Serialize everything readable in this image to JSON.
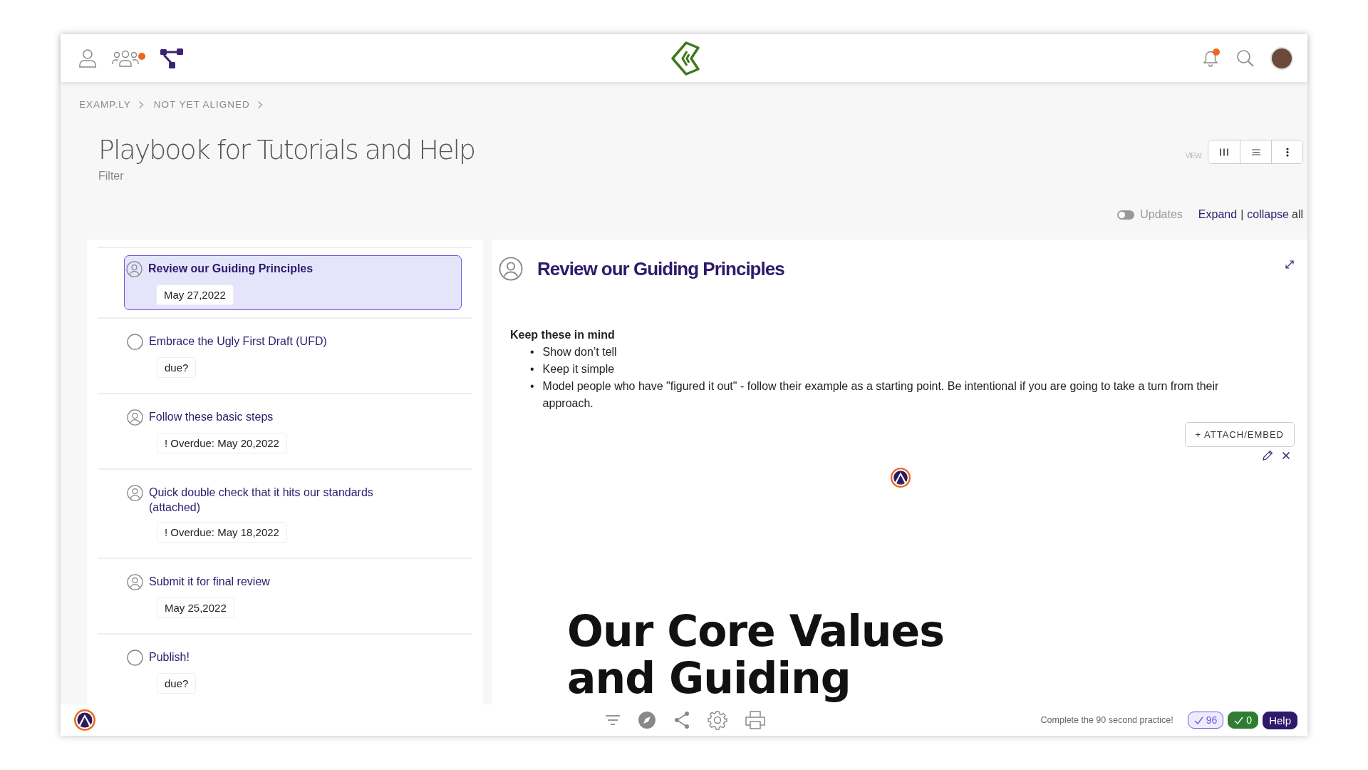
{
  "top_bar": {
    "people_has_alert": true,
    "bell_has_alert": true
  },
  "breadcrumb": [
    "EXAMP.LY",
    "NOT YET ALIGNED"
  ],
  "page": {
    "title": "Playbook for Tutorials and Help",
    "filter_label": "Filter"
  },
  "view": {
    "label": "VIEW:",
    "buttons": [
      {
        "kind": "columns",
        "selected": false
      },
      {
        "kind": "list",
        "selected": false
      },
      {
        "kind": "more",
        "selected": false
      }
    ]
  },
  "updates_toggle": {
    "label": "Updates",
    "on": false
  },
  "expand_controls": {
    "expand": "Expand",
    "separator": "|",
    "collapse": "collapse",
    "all": "all"
  },
  "tasks": [
    {
      "title": "Review our Guiding Principles",
      "due": "May 27,2022",
      "assigned": true,
      "selected": true
    },
    {
      "title": "Embrace the Ugly First Draft (UFD)",
      "due": "due?",
      "assigned": false,
      "selected": false
    },
    {
      "title": "Follow these basic steps",
      "due": "! Overdue: May 20,2022",
      "assigned": true,
      "selected": false
    },
    {
      "title": "Quick double check that it hits our standards (attached)",
      "due": "! Overdue: May 18,2022",
      "assigned": true,
      "selected": false
    },
    {
      "title": "Submit it for final review",
      "due": "May 25,2022",
      "assigned": true,
      "selected": false
    },
    {
      "title": "Publish!",
      "due": "due?",
      "assigned": false,
      "selected": false
    }
  ],
  "detail": {
    "title": "Review our Guiding Principles",
    "assigned": true,
    "heading": "Keep these in mind",
    "bullets": [
      {
        "marker": "•",
        "text": "Show don’t tell"
      },
      {
        "marker": "•",
        "text": "Keep it simple"
      },
      {
        "marker": "•",
        "text": "Model people who have \"figured it out\" - follow their example as a starting point.  Be intentional if you are going to take a turn from their approach."
      }
    ],
    "attach_button": "+ ATTACH/EMBED",
    "embed_heading": "Our Core Values and Guiding"
  },
  "bottom_bar": {
    "prompt": "Complete the 90 second practice!",
    "badges": [
      {
        "kind": "outline",
        "text": "96"
      },
      {
        "kind": "filled",
        "text": "0"
      }
    ],
    "help": "Help"
  }
}
